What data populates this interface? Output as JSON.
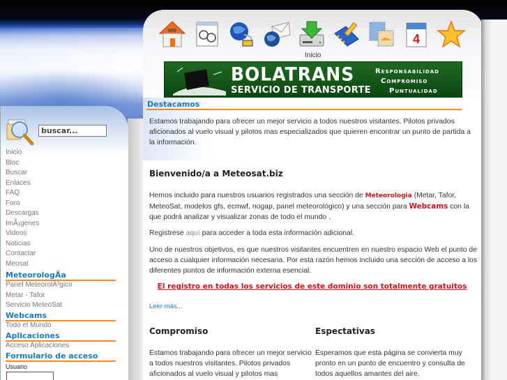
{
  "toolbar": {
    "icons": [
      {
        "name": "home-icon",
        "title": "Inicio"
      },
      {
        "name": "glasses-document-icon"
      },
      {
        "name": "globe-network-icon"
      },
      {
        "name": "globe-mail-icon"
      },
      {
        "name": "download-drive-icon"
      },
      {
        "name": "edit-folder-icon"
      },
      {
        "name": "stamps-icon"
      },
      {
        "name": "calendar-icon",
        "text": "4"
      },
      {
        "name": "star-icon"
      }
    ],
    "hover_label": "Inicio"
  },
  "banner": {
    "brand": "BOLATRANS",
    "subtitle": "SERVICIO DE TRANSPORTE",
    "slogans": [
      "Responsabilidad",
      "Compromiso",
      "Puntualidad"
    ],
    "color": "#1f6a22"
  },
  "sidebar": {
    "search_placeholder": "buscar...",
    "nav": [
      "Inicio",
      "Bloc",
      "Buscar",
      "Enlaces",
      "FAQ",
      "Foro",
      "Descargas",
      "ImÃ¡genes",
      "Videos",
      "Noticias",
      "Contactar",
      "Meosat"
    ],
    "categories": [
      {
        "title": "MeteorologÃa",
        "items": [
          "Panel MeteorolÃ³gico",
          "Metar - Tafor",
          "Servicio MeteoSat"
        ]
      },
      {
        "title": "Webcams",
        "items": [
          "Todo el Mundo"
        ]
      },
      {
        "title": "Aplicaciones",
        "items": [
          "Acceso Aplicaciones"
        ]
      },
      {
        "title": "Formulario de acceso",
        "items": []
      }
    ],
    "login": {
      "user_label": "Usuario",
      "user_value": ""
    }
  },
  "main": {
    "section_title": "Destacamos",
    "intro": "Estamos trabajando para ofrecer un mejor servicio a todos nuestros visitantes. Pilotos privados aficionados al vuelo visual y pilotos mas especializados que quieren encontrar un punto de partida a la información.",
    "welcome_title": "Bienvenido/a a Meteosat.biz",
    "p1_a": "Hemos incluido para nuestros usuarios registrados una sección de ",
    "p1_link1": "Meteorologia",
    "p1_b": " (Metar, Tafor, MeteoSat, modelos gfs, ecmwf, nogap,  panel meteorológico) y una sección para ",
    "p1_link2": "Webcams",
    "p1_c": " con la que podrá analizar y visualizar zonas de todo el mundo .",
    "p2_a": "Registrese ",
    "p2_link": "aquí",
    "p2_b": "  para acceder a toda esta información adicional.",
    "p3": "Uno de nuestros objetivos, es que nuestros visitantes encuentren en nuestro espacio Web el punto de acceso a cualquier información necesaria. Por esta razón hemos incluido una sección de acceso a los diferentes puntos de información externa esencial.",
    "notice": "El registro en todas los servicios de este dominio son totalmente gratuitos",
    "read_more": "Leer más...",
    "col1_title": "Compromiso",
    "col1_text": "Estamos trabajando para ofrecer un mejor servicio a todos nuestros visitantes. Pilotos privados aficionados al vuelo visual y pilotos mas",
    "col2_title": "Espectativas",
    "col2_text": "Esperamos que esta página se convierta muy pronto en un punto de encuentro y consulta de todos aquellos amantes del aire."
  },
  "colors": {
    "accent_blue": "#1a7ac0",
    "accent_orange": "#f08a24",
    "link_red": "#d4121a"
  }
}
